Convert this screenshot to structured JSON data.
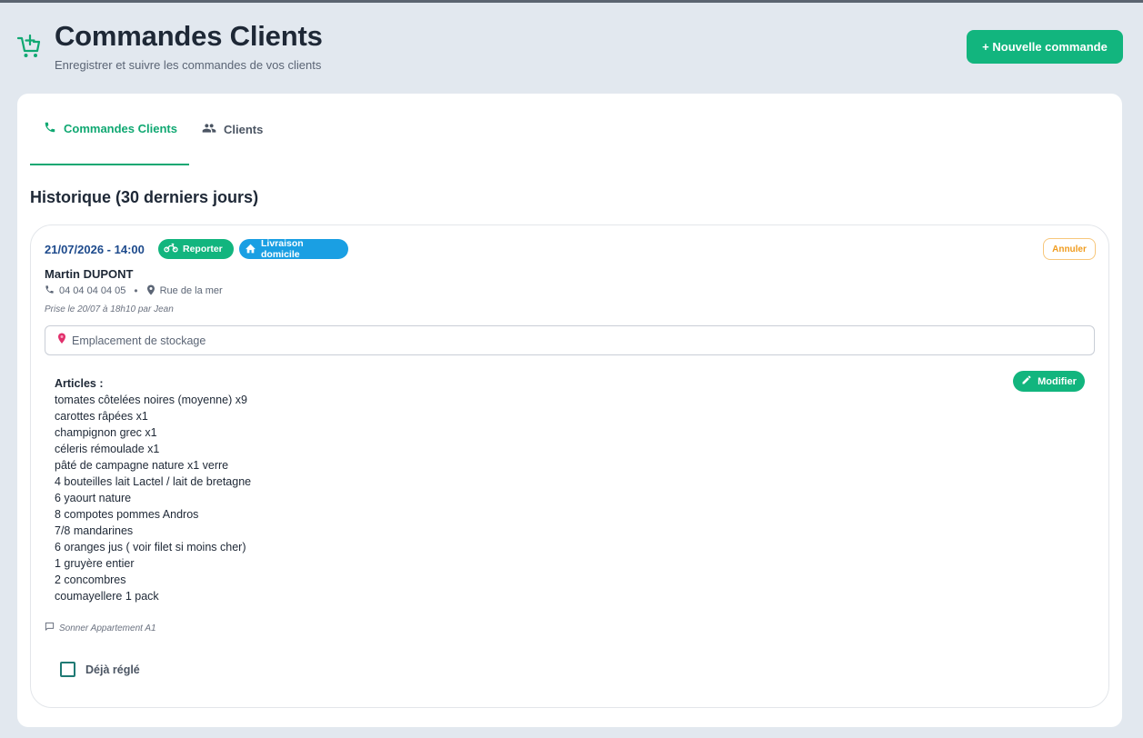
{
  "header": {
    "icon": "cart-add-icon",
    "title": "Commandes Clients",
    "subtitle": "Enregistrer et suivre les commandes de vos clients",
    "new_order_label": "+ Nouvelle commande"
  },
  "tabs": [
    {
      "label": "Commandes Clients",
      "icon": "phone-icon",
      "active": true
    },
    {
      "label": "Clients",
      "icon": "people-icon",
      "active": false
    }
  ],
  "history": {
    "title": "Historique (30 derniers jours)"
  },
  "order": {
    "datetime": "21/07/2026 - 14:00",
    "badges": [
      {
        "label": "Reporter",
        "icon": "motorbike-icon",
        "color": "#12b57e"
      },
      {
        "label": "Livraison domicile",
        "icon": "home-icon",
        "color": "#1a9fe3"
      }
    ],
    "cancel_label": "Annuler",
    "client_name": "Martin DUPONT",
    "phone": "04 04 04 04 05",
    "address": "Rue de la mer",
    "taken_note": "Prise le 20/07 à 18h10 par Jean",
    "storage_placeholder": "Emplacement de stockage",
    "articles_title": "Articles :",
    "edit_label": "Modifier",
    "articles": [
      "tomates côtelées noires (moyenne) x9",
      "carottes râpées x1",
      "champignon grec x1",
      "céleris rémoulade x1",
      "pâté de campagne nature x1 verre",
      "4 bouteilles lait Lactel / lait de bretagne",
      "6 yaourt nature",
      "8 compotes pommes Andros",
      "7/8 mandarines",
      "6 oranges jus ( voir filet si moins cher)",
      "1 gruyère entier",
      "2 concombres",
      "coumayellere 1 pack"
    ],
    "comment": "Sonner Appartement A1",
    "paid_label": "Déjà réglé",
    "paid_checked": false
  },
  "colors": {
    "accent": "#12b57e",
    "delivery": "#1a9fe3",
    "cancel": "#f09c1f",
    "date": "#1d4a8c",
    "background": "#e2e8ef"
  }
}
